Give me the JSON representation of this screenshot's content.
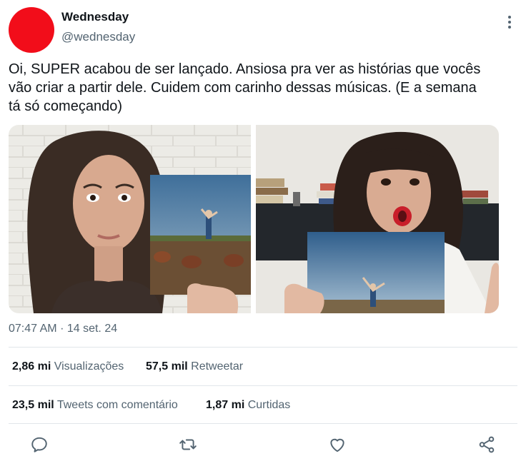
{
  "user": {
    "display_name": "Wednesday",
    "handle": "@wednesday",
    "avatar_color": "#f20d1a"
  },
  "tweet": {
    "text_line1": "Oi, SUPER acabou de ser lançado. Ansiosa pra ver as histórias que vocês",
    "text_line2": "vão criar a partir dele. Cuidem com carinho dessas músicas. (E a semana",
    "text_line3": "tá só começando)",
    "time": "07:47 AM",
    "separator": "·",
    "date": "14 set. 24"
  },
  "stats": {
    "views_count": "2,86 mi",
    "views_label": "Visualizações",
    "retweets_count": "57,5 mil",
    "retweets_label": "Retweetar",
    "quotes_count": "23,5 mil",
    "quotes_label": "Tweets com comentário",
    "likes_count": "1,87 mi",
    "likes_label": "Curtidas"
  },
  "icons": {
    "more": "more-vertical-icon",
    "reply": "reply-icon",
    "retweet": "retweet-icon",
    "like": "heart-icon",
    "share": "share-icon"
  },
  "colors": {
    "text": "#0f1419",
    "secondary": "#536471",
    "divider": "#e1e6ea"
  }
}
